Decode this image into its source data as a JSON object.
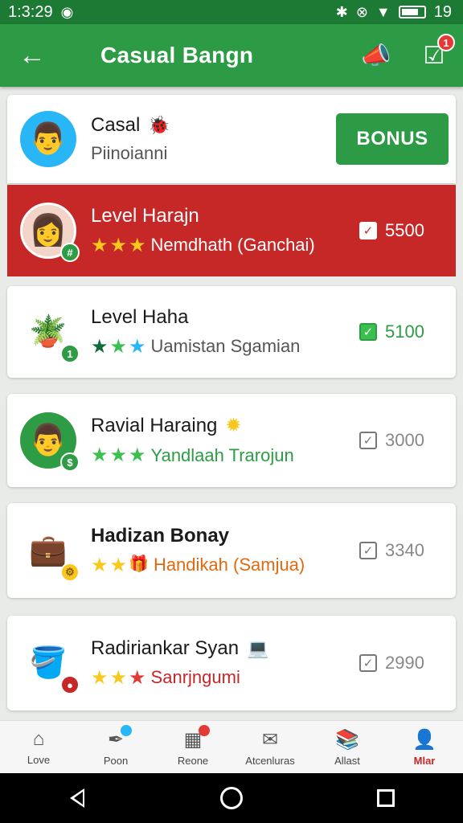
{
  "status_bar": {
    "time": "1:3:29",
    "battery_level": "19"
  },
  "app_bar": {
    "title": "Casual Bangn",
    "notification_count": "1"
  },
  "profile": {
    "name": "Casal",
    "subtitle": "Piinoianni",
    "bonus_label": "BONUS"
  },
  "rows": [
    {
      "name": "Level Harajn",
      "subtitle": "Nemdhath (Ganchai)",
      "score": "5500",
      "stars": [
        "★",
        "★",
        "★"
      ],
      "badge": "#",
      "name_color": "#ffffff",
      "sub_color": "#ffffff",
      "score_color": "#ffffff",
      "avatar_bg": "#f3d4c8",
      "avatar_glyph": "👩"
    },
    {
      "name": "Level Haha",
      "subtitle": "Uamistan Sgamian",
      "score": "5100",
      "stars": [
        "★",
        "★",
        "★"
      ],
      "badge": "1",
      "name_color": "#1b1b1b",
      "sub_color": "#555555",
      "score_color": "#2e9b45",
      "avatar_bg": "#ffffff",
      "avatar_glyph": "🪴"
    },
    {
      "name": "Ravial Haraing",
      "subtitle": "Yandlaah Trarojun",
      "score": "3000",
      "stars": [
        "★",
        "★",
        "★"
      ],
      "badge": "$",
      "name_color": "#1b1b1b",
      "sub_color": "#2e9b45",
      "score_color": "#888888",
      "avatar_bg": "#2e9b45",
      "avatar_glyph": "👨"
    },
    {
      "name": "Hadizan Bonay",
      "subtitle": "Handikah (Samjua)",
      "score": "3340",
      "stars": [
        "★",
        "★"
      ],
      "badge": "",
      "name_color": "#1b1b1b",
      "sub_color": "#e06a10",
      "score_color": "#888888",
      "avatar_bg": "#ffffff",
      "avatar_glyph": "💼"
    },
    {
      "name": "Radiriankar Syan",
      "subtitle": "Sanrjngumi",
      "score": "2990",
      "stars": [
        "★",
        "★",
        "★"
      ],
      "badge": "",
      "name_color": "#1b1b1b",
      "sub_color": "#c62828",
      "score_color": "#888888",
      "avatar_bg": "#ffffff",
      "avatar_glyph": "🪣"
    }
  ],
  "bottom_nav": [
    {
      "label": "Love",
      "icon": "home-icon"
    },
    {
      "label": "Poon",
      "icon": "pen-icon"
    },
    {
      "label": "Reone",
      "icon": "grid-icon"
    },
    {
      "label": "Atcenluras",
      "icon": "mail-icon"
    },
    {
      "label": "Allast",
      "icon": "book-icon"
    },
    {
      "label": "Mlar",
      "icon": "profile-icon"
    }
  ],
  "colors": {
    "primary": "#2d9a46",
    "status_bar": "#1c7a34",
    "highlight": "#c62828",
    "accent_red": "#e53935"
  }
}
